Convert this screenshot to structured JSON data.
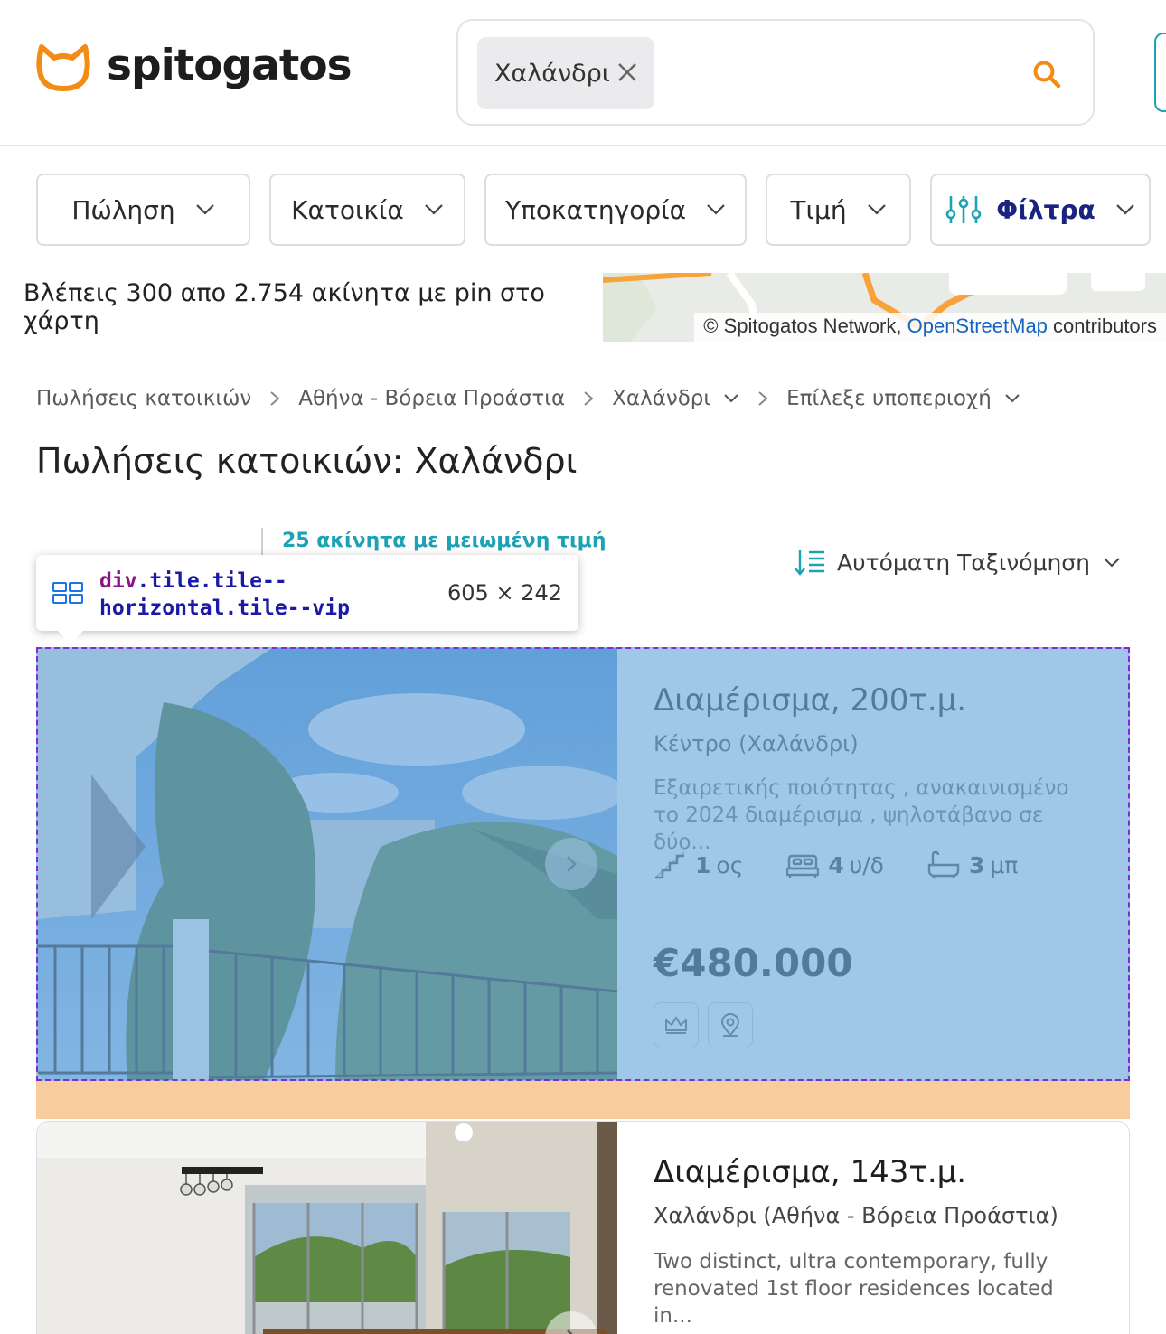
{
  "header": {
    "brand": "spitogatos",
    "search": {
      "chip_label": "Χαλάνδρι"
    },
    "colors": {
      "accent": "#f28c14",
      "brand_dark": "#1a237e",
      "teal": "#1da1b5"
    }
  },
  "filters": [
    {
      "label": "Πώληση"
    },
    {
      "label": "Κατοικία"
    },
    {
      "label": "Υποκατηγορία"
    },
    {
      "label": "Τιμή"
    },
    {
      "label": "Φίλτρα"
    }
  ],
  "map": {
    "count_text": "Βλέπεις 300 απο 2.754 ακίνητα με pin στο χάρτη",
    "attribution_prefix": "© Spitogatos Network,",
    "attribution_link": "OpenStreetMap",
    "attribution_suffix": "contributors"
  },
  "breadcrumb": [
    {
      "label": "Πωλήσεις κατοικιών"
    },
    {
      "label": "Αθήνα - Βόρεια Προάστια"
    },
    {
      "label": "Χαλάνδρι"
    },
    {
      "label": "Επίλεξε υποπεριοχή"
    }
  ],
  "page_title": "Πωλήσεις κατοικιών: Χαλάνδρι",
  "reduced_price_link": "25 ακίνητα με μειωμένη τιμή",
  "sort_label": "Αυτόματη Ταξινόμηση",
  "devtools_tooltip": {
    "tag": "div",
    "classes": ".tile.tile--horizontal.tile--vip",
    "size": "605 × 242"
  },
  "listings": [
    {
      "title": "Διαμέρισμα, 200τ.μ.",
      "location": "Κέντρο (Χαλάνδρι)",
      "description": "Εξαιρετικής ποιότητας , ανακαινισμένο το 2024 διαμέρισμα , ψηλοτάβανο σε δύο...",
      "floor": "1",
      "floor_unit": "ος",
      "bedrooms": "4",
      "bedrooms_unit": "υ/δ",
      "bathrooms": "3",
      "bathrooms_unit": "μπ",
      "price": "€480.000"
    },
    {
      "title": "Διαμέρισμα, 143τ.μ.",
      "location": "Χαλάνδρι (Αθήνα - Βόρεια Προάστια)",
      "description": "Two distinct, ultra contemporary, fully renovated 1st floor residences located in..."
    }
  ]
}
